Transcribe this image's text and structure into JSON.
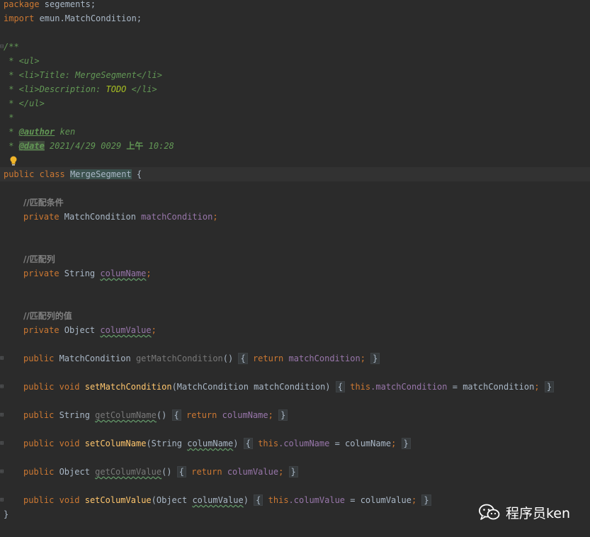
{
  "editor": {
    "line_package": {
      "kw": "package",
      "rest": " segements;"
    },
    "line_import": {
      "kw": "import",
      "rest": " emun.MatchCondition;"
    },
    "doc": {
      "open": "/**",
      "ul_open": " * <ul>",
      "li_title_pre": " * <li>",
      "li_title_text": "Title: MergeSegment",
      "li_title_post": "</li>",
      "li_desc_pre": " * <li>",
      "li_desc_text": "Description: ",
      "li_desc_todo": "TODO",
      "li_desc_post": " </li>",
      "ul_close": " * </ul>",
      "blank": " *",
      "author_pre": " * ",
      "author_tag": "@author",
      "author_val": " ken",
      "date_pre": " * ",
      "date_tag": "@date",
      "date_val": " 2021/4/29 0029 ",
      "date_ampm": "上午",
      "date_time": " 10:28"
    },
    "class_decl": {
      "kw1": "public",
      "kw2": "class",
      "name": "MergeSegment",
      "brace": " {"
    },
    "comment_match": "//匹配条件",
    "field_match": {
      "kw": "private",
      "type": " MatchCondition ",
      "name": "matchCondition",
      "semi": ";"
    },
    "comment_col": "//匹配列",
    "field_col": {
      "kw": "private",
      "type": " String ",
      "name": "columName",
      "semi": ";"
    },
    "comment_val": "//匹配列的值",
    "field_val": {
      "kw": "private",
      "type": " Object ",
      "name": "columValue",
      "semi": ";"
    },
    "m1": {
      "kw": "public",
      "type": " MatchCondition ",
      "name": "getMatchCondition",
      "parens": "()",
      "open": "{",
      "ret": "return",
      "field": "matchCondition",
      "semi": ";",
      "close": "}"
    },
    "m2": {
      "kw": "public",
      "void": "void",
      "name": "setMatchCondition",
      "params": "(MatchCondition matchCondition)",
      "open": "{",
      "this": "this",
      "field": ".matchCondition",
      "assign": " = matchCondition",
      "semi": ";",
      "close": "}"
    },
    "m3": {
      "kw": "public",
      "type": " String ",
      "name": "getColumName",
      "parens": "()",
      "open": "{",
      "ret": "return",
      "field": "columName",
      "semi": ";",
      "close": "}"
    },
    "m4": {
      "kw": "public",
      "void": "void",
      "name": "setColumName",
      "params_a": "(String ",
      "params_b": "columName",
      "params_c": ")",
      "open": "{",
      "this": "this",
      "field": ".columName",
      "assign": " = columName",
      "semi": ";",
      "close": "}"
    },
    "m5": {
      "kw": "public",
      "type": " Object ",
      "name": "getColumValue",
      "parens": "()",
      "open": "{",
      "ret": "return",
      "field": "columValue",
      "semi": ";",
      "close": "}"
    },
    "m6": {
      "kw": "public",
      "void": "void",
      "name": "setColumValue",
      "params_a": "(Object ",
      "params_b": "columValue",
      "params_c": ")",
      "open": "{",
      "this": "this",
      "field": ".columValue",
      "assign": " = columValue",
      "semi": ";",
      "close": "}"
    },
    "class_close": "}"
  },
  "watermark": {
    "text": "程序员ken",
    "icon": "wechat-icon"
  },
  "colors": {
    "background": "#2b2b2b",
    "keyword": "#cc7832",
    "field": "#9876aa",
    "method": "#ffc66d",
    "doc": "#629755",
    "comment": "#808080"
  }
}
